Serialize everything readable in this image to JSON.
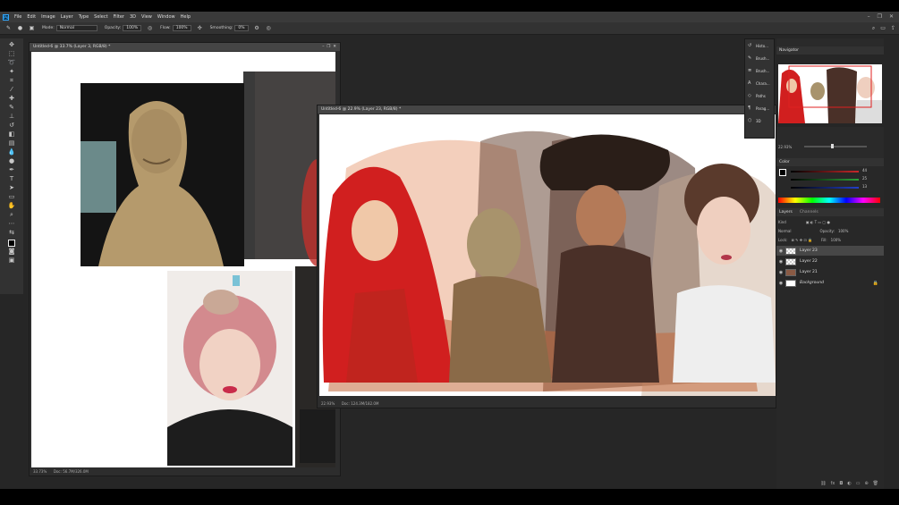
{
  "menubar": {
    "logo": "Ps",
    "items": [
      "File",
      "Edit",
      "Image",
      "Layer",
      "Type",
      "Select",
      "Filter",
      "3D",
      "View",
      "Window",
      "Help"
    ]
  },
  "optionsbar": {
    "mode_label": "Mode:",
    "mode_value": "Normal",
    "opacity_label": "Opacity:",
    "opacity_value": "100%",
    "flow_label": "Flow:",
    "flow_value": "100%",
    "smoothing_label": "Smoothing:",
    "smoothing_value": "0%"
  },
  "doc1": {
    "title": "Untitled-6 @ 33.7% (Layer 3, RGB/8) *",
    "zoom": "33.73%",
    "doc_info": "Doc: 56.7M/326.0M"
  },
  "doc2": {
    "title": "Untitled-6 @ 22.9% (Layer 23, RGB/8) *",
    "zoom": "22.93%",
    "doc_info": "Doc: 124.3M/182.0M"
  },
  "mini_dock": {
    "items": [
      {
        "icon": "history-icon",
        "label": "Histo..."
      },
      {
        "icon": "brush-icon",
        "label": "Brush..."
      },
      {
        "icon": "brush-settings-icon",
        "label": "Brush..."
      },
      {
        "icon": "character-icon",
        "label": "Chara..."
      },
      {
        "icon": "paths-icon",
        "label": "Paths"
      },
      {
        "icon": "paragraph-icon",
        "label": "Parag..."
      },
      {
        "icon": "3d-icon",
        "label": "3D"
      }
    ]
  },
  "navigator": {
    "tab": "Navigator",
    "zoom": "22.93%"
  },
  "color": {
    "tab": "Color",
    "r": "44",
    "g": "25",
    "b": "13",
    "colors": {
      "red": "#c8282a",
      "green": "#2ba43a",
      "blue": "#2240c8"
    }
  },
  "layers": {
    "tabs": [
      "Layers",
      "Channels"
    ],
    "kind": "Kind",
    "blend": "Normal",
    "opacity_label": "Opacity:",
    "opacity_value": "100%",
    "lock_label": "Lock:",
    "fill_label": "Fill:",
    "fill_value": "100%",
    "items": [
      {
        "name": "Layer 23",
        "active": true
      },
      {
        "name": "Layer 22",
        "active": false
      },
      {
        "name": "Layer 21",
        "active": false
      },
      {
        "name": "Background",
        "active": false,
        "locked": true
      }
    ]
  },
  "colors": {
    "app_bg": "#262626",
    "panel": "#323232",
    "accent": "#31a8ff"
  }
}
